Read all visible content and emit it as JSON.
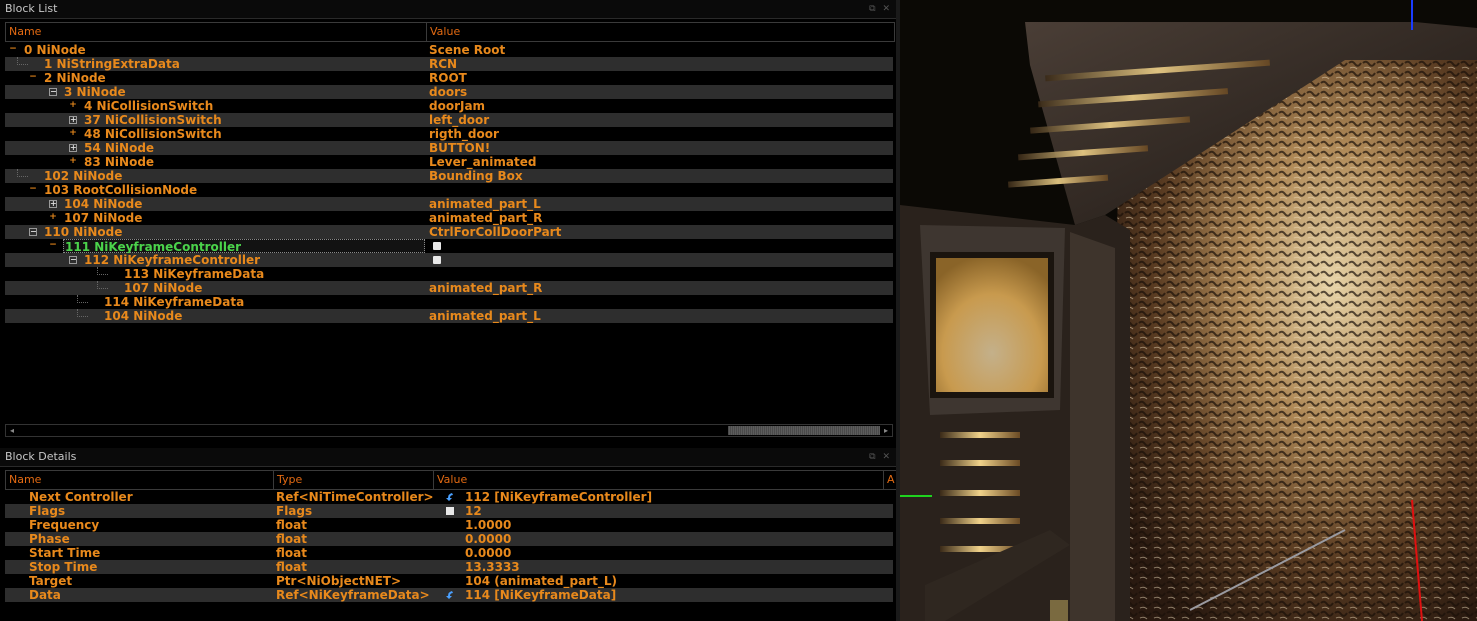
{
  "block_list": {
    "title": "Block List",
    "columns": [
      "Name",
      "Value"
    ],
    "rows": [
      {
        "name": "0 NiNode",
        "value": "Scene Root",
        "depth": 0,
        "toggle": "-"
      },
      {
        "name": "1 NiStringExtraData",
        "value": "RCN",
        "depth": 1,
        "toggle": ""
      },
      {
        "name": "2 NiNode",
        "value": "ROOT",
        "depth": 1,
        "toggle": "-"
      },
      {
        "name": "3 NiNode",
        "value": "doors",
        "depth": 2,
        "toggle": "box-minus"
      },
      {
        "name": "4 NiCollisionSwitch",
        "value": "doorJam",
        "depth": 3,
        "toggle": "+"
      },
      {
        "name": "37 NiCollisionSwitch",
        "value": "left_door",
        "depth": 3,
        "toggle": "box-plus"
      },
      {
        "name": "48 NiCollisionSwitch",
        "value": "rigth_door",
        "depth": 3,
        "toggle": "+"
      },
      {
        "name": "54 NiNode",
        "value": "BUTTON!",
        "depth": 3,
        "toggle": "box-plus"
      },
      {
        "name": "83 NiNode",
        "value": "Lever_animated",
        "depth": 3,
        "toggle": "+"
      },
      {
        "name": "102 NiNode",
        "value": "Bounding Box",
        "depth": 1,
        "toggle": ""
      },
      {
        "name": "103 RootCollisionNode",
        "value": "",
        "depth": 1,
        "toggle": "-"
      },
      {
        "name": "104 NiNode",
        "value": "animated_part_L",
        "depth": 2,
        "toggle": "box-plus"
      },
      {
        "name": "107 NiNode",
        "value": "animated_part_R",
        "depth": 2,
        "toggle": "+"
      },
      {
        "name": "110 NiNode",
        "value": "CtrlForCollDoorPart",
        "depth": 1,
        "toggle": "box-minus"
      },
      {
        "name": "111 NiKeyframeController",
        "value": "",
        "value_icon": "flag-icon",
        "depth": 2,
        "toggle": "-",
        "selected": true
      },
      {
        "name": "112 NiKeyframeController",
        "value": "",
        "value_icon": "flag-icon",
        "depth": 3,
        "toggle": "box-minus"
      },
      {
        "name": "113 NiKeyframeData",
        "value": "",
        "depth": 5,
        "toggle": ""
      },
      {
        "name": "107 NiNode",
        "value": "animated_part_R",
        "depth": 5,
        "toggle": ""
      },
      {
        "name": "114 NiKeyframeData",
        "value": "",
        "depth": 4,
        "toggle": ""
      },
      {
        "name": "104 NiNode",
        "value": "animated_part_L",
        "depth": 4,
        "toggle": ""
      }
    ]
  },
  "block_details": {
    "title": "Block Details",
    "columns": [
      "Name",
      "Type",
      "Value",
      "A"
    ],
    "rows": [
      {
        "name": "Next Controller",
        "type": "Ref<NiTimeController>",
        "value": "112 [NiKeyframeController]",
        "icon": "link-icon"
      },
      {
        "name": "Flags",
        "type": "Flags",
        "value": "12",
        "icon": "flag-icon"
      },
      {
        "name": "Frequency",
        "type": "float",
        "value": "1.0000",
        "icon": ""
      },
      {
        "name": "Phase",
        "type": "float",
        "value": "0.0000",
        "icon": ""
      },
      {
        "name": "Start Time",
        "type": "float",
        "value": "0.0000",
        "icon": ""
      },
      {
        "name": "Stop Time",
        "type": "float",
        "value": "13.3333",
        "icon": ""
      },
      {
        "name": "Target",
        "type": "Ptr<NiObjectNET>",
        "value": "104 (animated_part_L)",
        "icon": ""
      },
      {
        "name": "Data",
        "type": "Ref<NiKeyframeData>",
        "value": "114 [NiKeyframeData]",
        "icon": "link-icon"
      }
    ]
  },
  "viewport": {
    "label": "3D render of door frame mesh"
  },
  "colors": {
    "text": "#e8891c",
    "selected": "#4bd34b",
    "alt_row": "#2e2e2e",
    "header": "#e36a12"
  }
}
